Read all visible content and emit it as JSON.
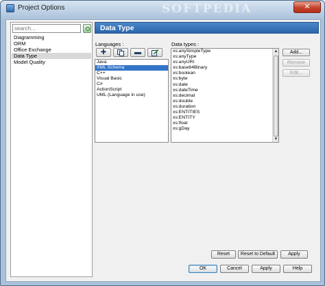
{
  "window": {
    "title": "Project Options",
    "watermark": "SOFTPEDIA",
    "close_glyph": "✕"
  },
  "search": {
    "placeholder": "search..."
  },
  "categories": [
    {
      "label": "Diagramming",
      "selected": false
    },
    {
      "label": "ORM",
      "selected": false
    },
    {
      "label": "Office Exchange",
      "selected": false
    },
    {
      "label": "Data Type",
      "selected": true
    },
    {
      "label": "Model Quality",
      "selected": false
    }
  ],
  "page": {
    "title": "Data Type"
  },
  "languages": {
    "label": "Languages :",
    "items": [
      {
        "label": "Java",
        "selected": false
      },
      {
        "label": "XML Schema",
        "selected": true
      },
      {
        "label": "C++",
        "selected": false
      },
      {
        "label": "Visual Basic",
        "selected": false
      },
      {
        "label": "C#",
        "selected": false
      },
      {
        "label": "ActionScript",
        "selected": false
      },
      {
        "label": "UML   (Language in use)",
        "selected": false
      }
    ],
    "toolbar": [
      {
        "name": "add-language-icon",
        "glyph": "✚"
      },
      {
        "name": "copy-language-icon",
        "glyph": ""
      },
      {
        "name": "remove-language-icon",
        "glyph": "▬"
      },
      {
        "name": "edit-language-icon",
        "glyph": ""
      }
    ]
  },
  "data_types": {
    "label": "Data types :",
    "items": [
      "xs:anySimpleType",
      "xs:anyType",
      "xs:anyURI",
      "xs:base64Binary",
      "xs:boolean",
      "xs:byte",
      "xs:date",
      "xs:dateTime",
      "xs:decimal",
      "xs:double",
      "xs:duration",
      "xs:ENTITIES",
      "xs:ENTITY",
      "xs:float",
      "xs:gDay"
    ],
    "scroll_up": "▲",
    "scroll_down": "▼"
  },
  "side_buttons": {
    "add": "Add...",
    "remove": "Remove",
    "edit": "Edit..."
  },
  "footer_buttons": {
    "reset": "Reset",
    "reset_default": "Reset to Default",
    "apply": "Apply",
    "ok": "OK",
    "cancel": "Cancel",
    "apply2": "Apply",
    "help": "Help"
  },
  "colors": {
    "header_bg": "#2b65ab",
    "selection": "#3375c6",
    "close_button": "#c2422a"
  }
}
